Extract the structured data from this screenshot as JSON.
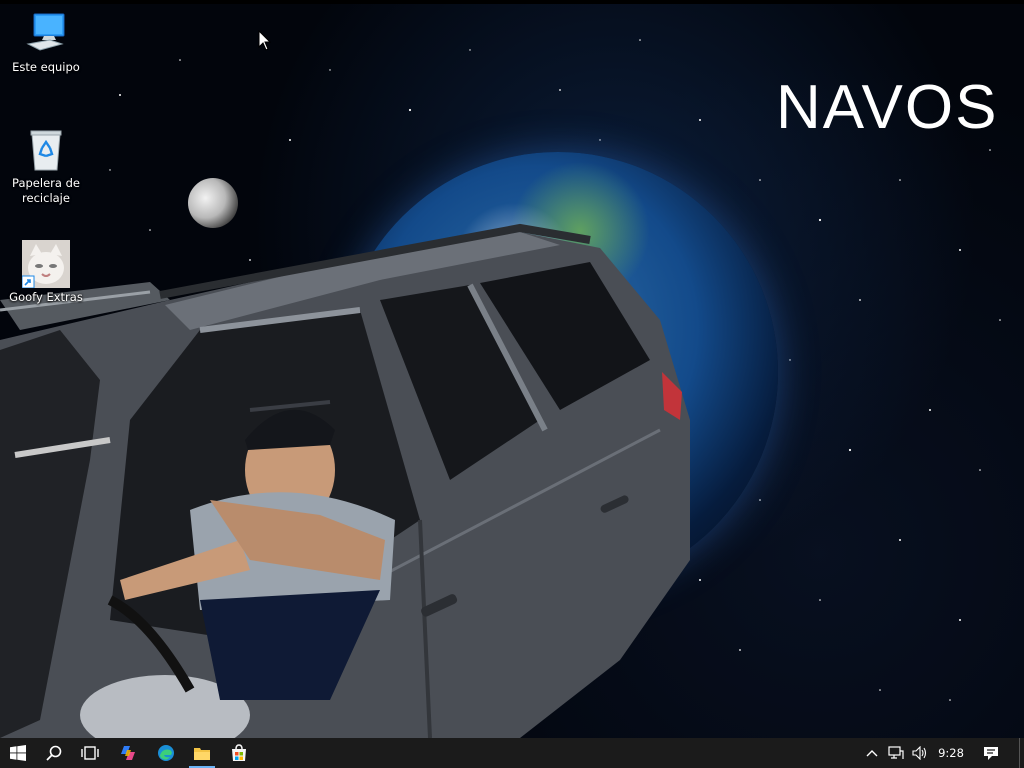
{
  "desktop": {
    "wallpaper_text": "NAVOS",
    "icons": [
      {
        "label": "Este equipo",
        "icon": "computer-icon"
      },
      {
        "label": "Papelera de reciclaje",
        "icon": "recycle-bin-icon"
      },
      {
        "label": "Goofy Extras",
        "icon": "shortcut-cat-icon"
      }
    ]
  },
  "taskbar": {
    "pinned": [
      {
        "name": "start",
        "icon": "windows-logo-icon"
      },
      {
        "name": "search",
        "icon": "search-icon"
      },
      {
        "name": "task-view",
        "icon": "task-view-icon"
      },
      {
        "name": "copilot",
        "icon": "copilot-icon"
      },
      {
        "name": "edge",
        "icon": "edge-icon"
      },
      {
        "name": "file-explorer",
        "icon": "folder-icon",
        "active": true
      },
      {
        "name": "store",
        "icon": "store-icon"
      }
    ],
    "tray": {
      "clock": "9:28",
      "icons": [
        "chevron-up-icon",
        "network-icon",
        "volume-icon",
        "notification-icon"
      ]
    }
  },
  "colors": {
    "taskbar_bg": "#1b1b1b",
    "active_indicator": "#6cb4f5",
    "space_bg": "#02050c"
  }
}
